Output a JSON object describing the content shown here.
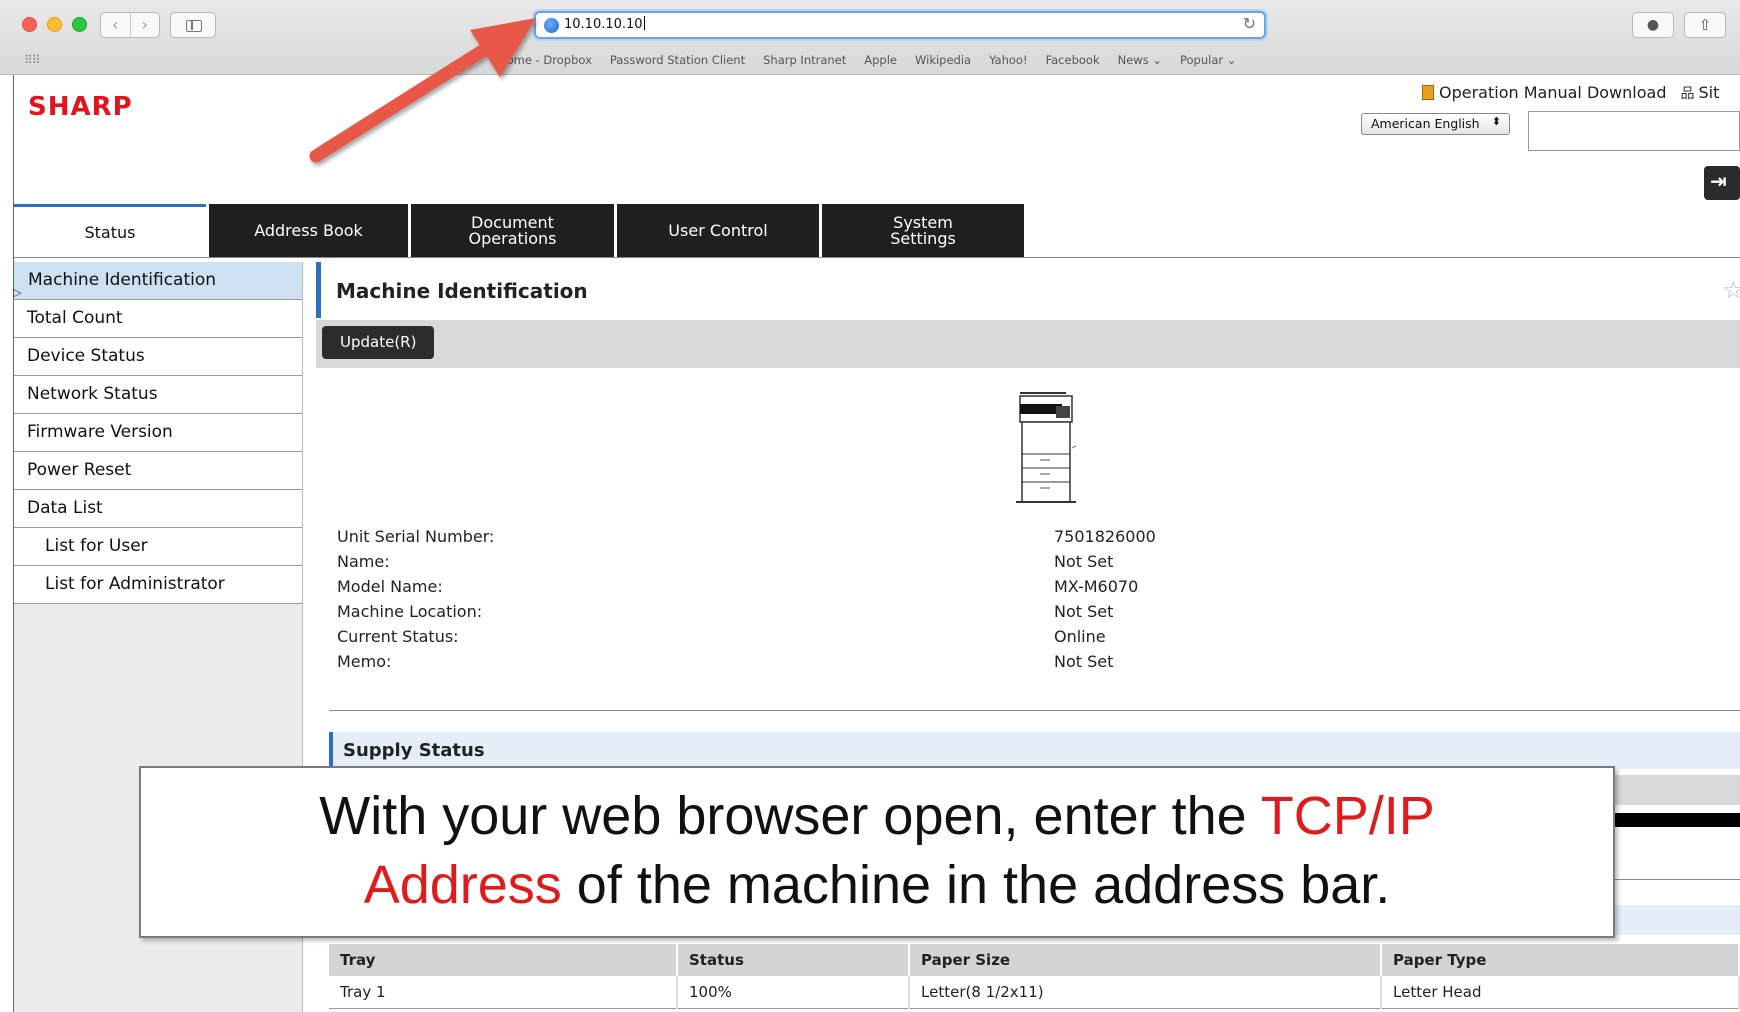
{
  "browser": {
    "url": "10.10.10.10",
    "bookmarks": [
      "Home - Dropbox",
      "Password Station Client",
      "Sharp Intranet",
      "Apple",
      "Wikipedia",
      "Yahoo!",
      "Facebook",
      "News ⌄",
      "Popular ⌄"
    ]
  },
  "header": {
    "logo": "SHARP",
    "manual_link": "Operation Manual Download",
    "sitemap_link": "Sit",
    "language": "American English"
  },
  "tabs": [
    {
      "label": "Status",
      "active": true
    },
    {
      "label": "Address Book"
    },
    {
      "label": "Document Operations"
    },
    {
      "label": "User Control"
    },
    {
      "label": "System Settings"
    }
  ],
  "leftnav": [
    {
      "label": "Machine Identification",
      "active": true
    },
    {
      "label": "Total Count"
    },
    {
      "label": "Device Status"
    },
    {
      "label": "Network Status"
    },
    {
      "label": "Firmware Version"
    },
    {
      "label": "Power Reset"
    },
    {
      "label": "Data List"
    },
    {
      "label": "List for User",
      "sub": true
    },
    {
      "label": "List for Administrator",
      "sub": true
    }
  ],
  "main": {
    "title": "Machine Identification",
    "update_button": "Update(R)",
    "info": [
      {
        "label": "Unit Serial Number:",
        "value": "7501826000"
      },
      {
        "label": "Name:",
        "value": "Not Set"
      },
      {
        "label": "Model Name:",
        "value": "MX-M6070"
      },
      {
        "label": "Machine Location:",
        "value": "Not Set"
      },
      {
        "label": "Current Status:",
        "value": "Online"
      },
      {
        "label": "Memo:",
        "value": "Not Set"
      }
    ],
    "supply_title": "Supply Status",
    "tray_table": {
      "headers": [
        "Tray",
        "Status",
        "Paper Size",
        "Paper Type"
      ],
      "rows": [
        [
          "Tray 1",
          "100%",
          "Letter(8 1/2x11)",
          "Letter Head"
        ]
      ]
    }
  },
  "callout": {
    "part1": "With your web browser open, enter the ",
    "highlight1": "TCP/IP",
    "highlight2": "Address",
    "part2": " of the machine in the address bar.",
    "highlight_color": "#e01b1b"
  },
  "colors": {
    "brand": "#e4141f",
    "accent": "#2a6fc0",
    "arrow": "#e8584a"
  }
}
